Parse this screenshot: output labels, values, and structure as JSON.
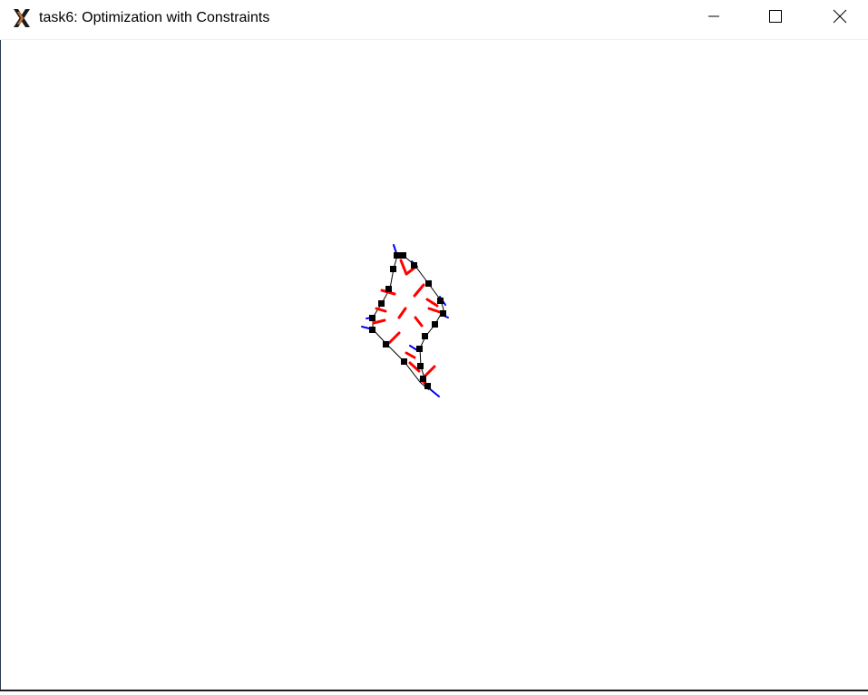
{
  "window": {
    "title": "task6: Optimization with Constraints",
    "app_icon": "x-window-icon",
    "controls": [
      "minimize-icon",
      "maximize-icon",
      "close-icon"
    ]
  },
  "colors": {
    "polygon_edge": "#000000",
    "vertex": "#000000",
    "force_red": "#ff0000",
    "force_blue": "#0000ff",
    "background": "#ffffff"
  }
}
